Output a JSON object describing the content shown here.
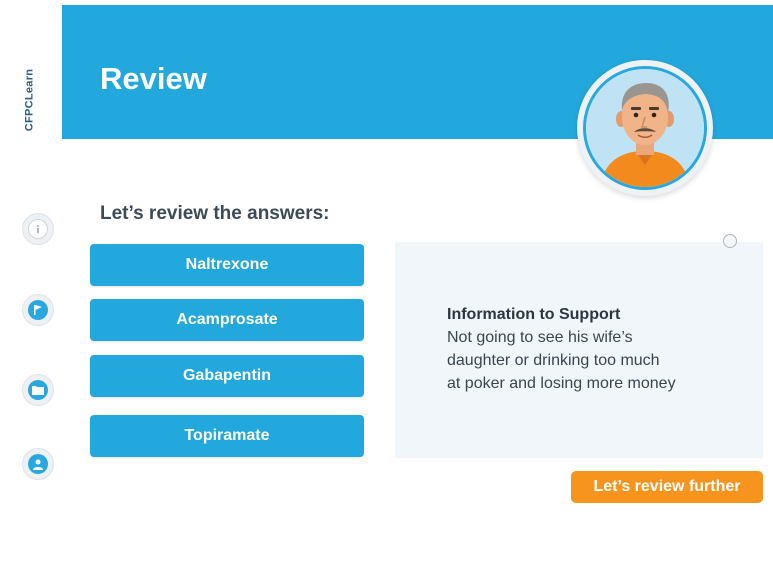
{
  "brand": {
    "logo_text": "CFPCLearn"
  },
  "header": {
    "title": "Review"
  },
  "main": {
    "subtitle": "Let’s review the answers:",
    "answers": [
      "Naltrexone",
      "Acamprosate",
      "Gabapentin",
      "Topiramate"
    ]
  },
  "info_panel": {
    "heading": "Information to Support",
    "lines": [
      "Not going to see his wife’s",
      "daughter or drinking too much",
      "at poker and losing more money"
    ]
  },
  "cta": {
    "label": "Let’s review further"
  },
  "sidebar": {
    "icons": [
      "info-icon",
      "flag-icon",
      "folder-icon",
      "user-icon"
    ]
  },
  "colors": {
    "accent_blue": "#23a8dd",
    "cta_orange": "#f7941d",
    "panel_bg": "#f1f6fb"
  }
}
